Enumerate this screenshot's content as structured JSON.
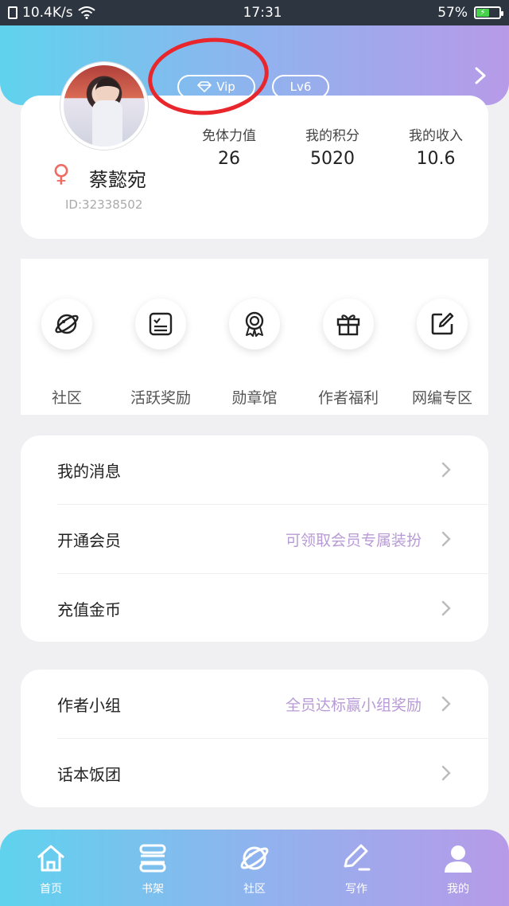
{
  "status_bar": {
    "net_speed": "10.4K/s",
    "time": "17:31",
    "battery_percent": "57%",
    "battery_level": 0.57
  },
  "profile": {
    "vip_label": "Vip",
    "level_label": "Lv6",
    "name": "蔡懿宛",
    "id": "ID:32338502",
    "gender_icon": "female-symbol",
    "stats": [
      {
        "label": "免体力值",
        "value": "26"
      },
      {
        "label": "我的积分",
        "value": "5020"
      },
      {
        "label": "我的收入",
        "value": "10.6"
      }
    ]
  },
  "grid": [
    {
      "label": "社区",
      "icon": "planet-icon"
    },
    {
      "label": "活跃奖励",
      "icon": "checklist-icon"
    },
    {
      "label": "勋章馆",
      "icon": "medal-icon"
    },
    {
      "label": "作者福利",
      "icon": "gift-icon"
    },
    {
      "label": "网编专区",
      "icon": "edit-icon"
    }
  ],
  "menu_group_1": [
    {
      "label": "我的消息",
      "hint": ""
    },
    {
      "label": "开通会员",
      "hint": "可领取会员专属装扮"
    },
    {
      "label": "充值金币",
      "hint": ""
    }
  ],
  "menu_group_2": [
    {
      "label": "作者小组",
      "hint": "全员达标赢小组奖励"
    },
    {
      "label": "话本饭团",
      "hint": ""
    }
  ],
  "bottom_nav": [
    {
      "label": "首页",
      "icon": "home-icon"
    },
    {
      "label": "书架",
      "icon": "bookshelf-icon"
    },
    {
      "label": "社区",
      "icon": "planet-icon"
    },
    {
      "label": "写作",
      "icon": "pen-icon"
    },
    {
      "label": "我的",
      "icon": "user-icon"
    }
  ],
  "colors": {
    "gradient_start": "#5fd3ee",
    "gradient_end": "#b79ae8",
    "hint_purple": "#b89bd6",
    "annotation_red": "#e8262b"
  }
}
